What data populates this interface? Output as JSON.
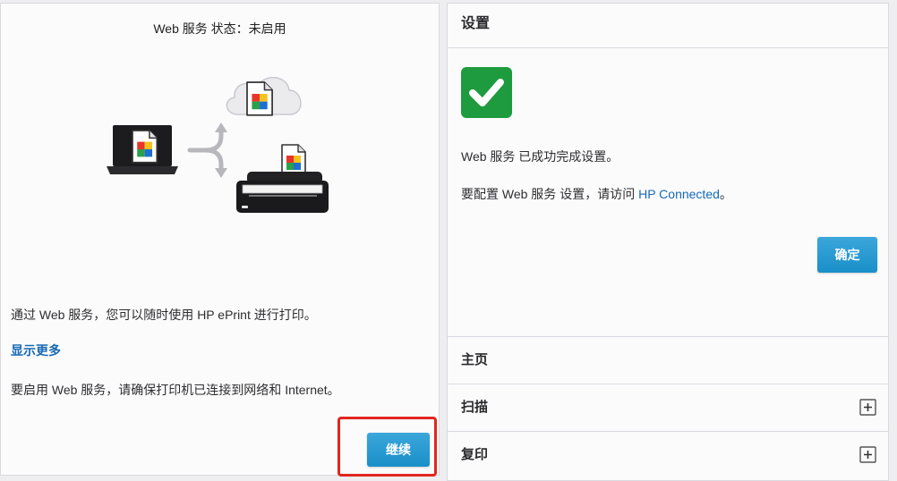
{
  "left": {
    "title": "Web 服务 状态：未启用",
    "illustration_icons": [
      "cloud-icon",
      "document-icon",
      "laptop-icon",
      "split-arrow-icon",
      "printer-icon"
    ],
    "description": "通过 Web 服务，您可以随时使用 HP ePrint 进行打印。",
    "show_more": "显示更多",
    "requirement": "要启用 Web 服务，请确保打印机已连接到网络和 Internet。",
    "continue_label": "继续"
  },
  "right": {
    "header": "设置",
    "status_icon": "checkmark-icon",
    "success_text": "Web 服务 已成功完成设置。",
    "config_prefix": "要配置 Web 服务 设置，请访问 ",
    "config_link": "HP Connected",
    "config_suffix": "。",
    "ok_label": "确定",
    "menu": [
      {
        "label": "主页",
        "icon": null
      },
      {
        "label": "扫描",
        "icon": "plus-square-icon"
      },
      {
        "label": "复印",
        "icon": "plus-square-icon"
      }
    ]
  },
  "colors": {
    "accent": "#1b98d5",
    "success": "#1f9b3f",
    "link": "#1769b3",
    "highlight": "#e0261f"
  }
}
